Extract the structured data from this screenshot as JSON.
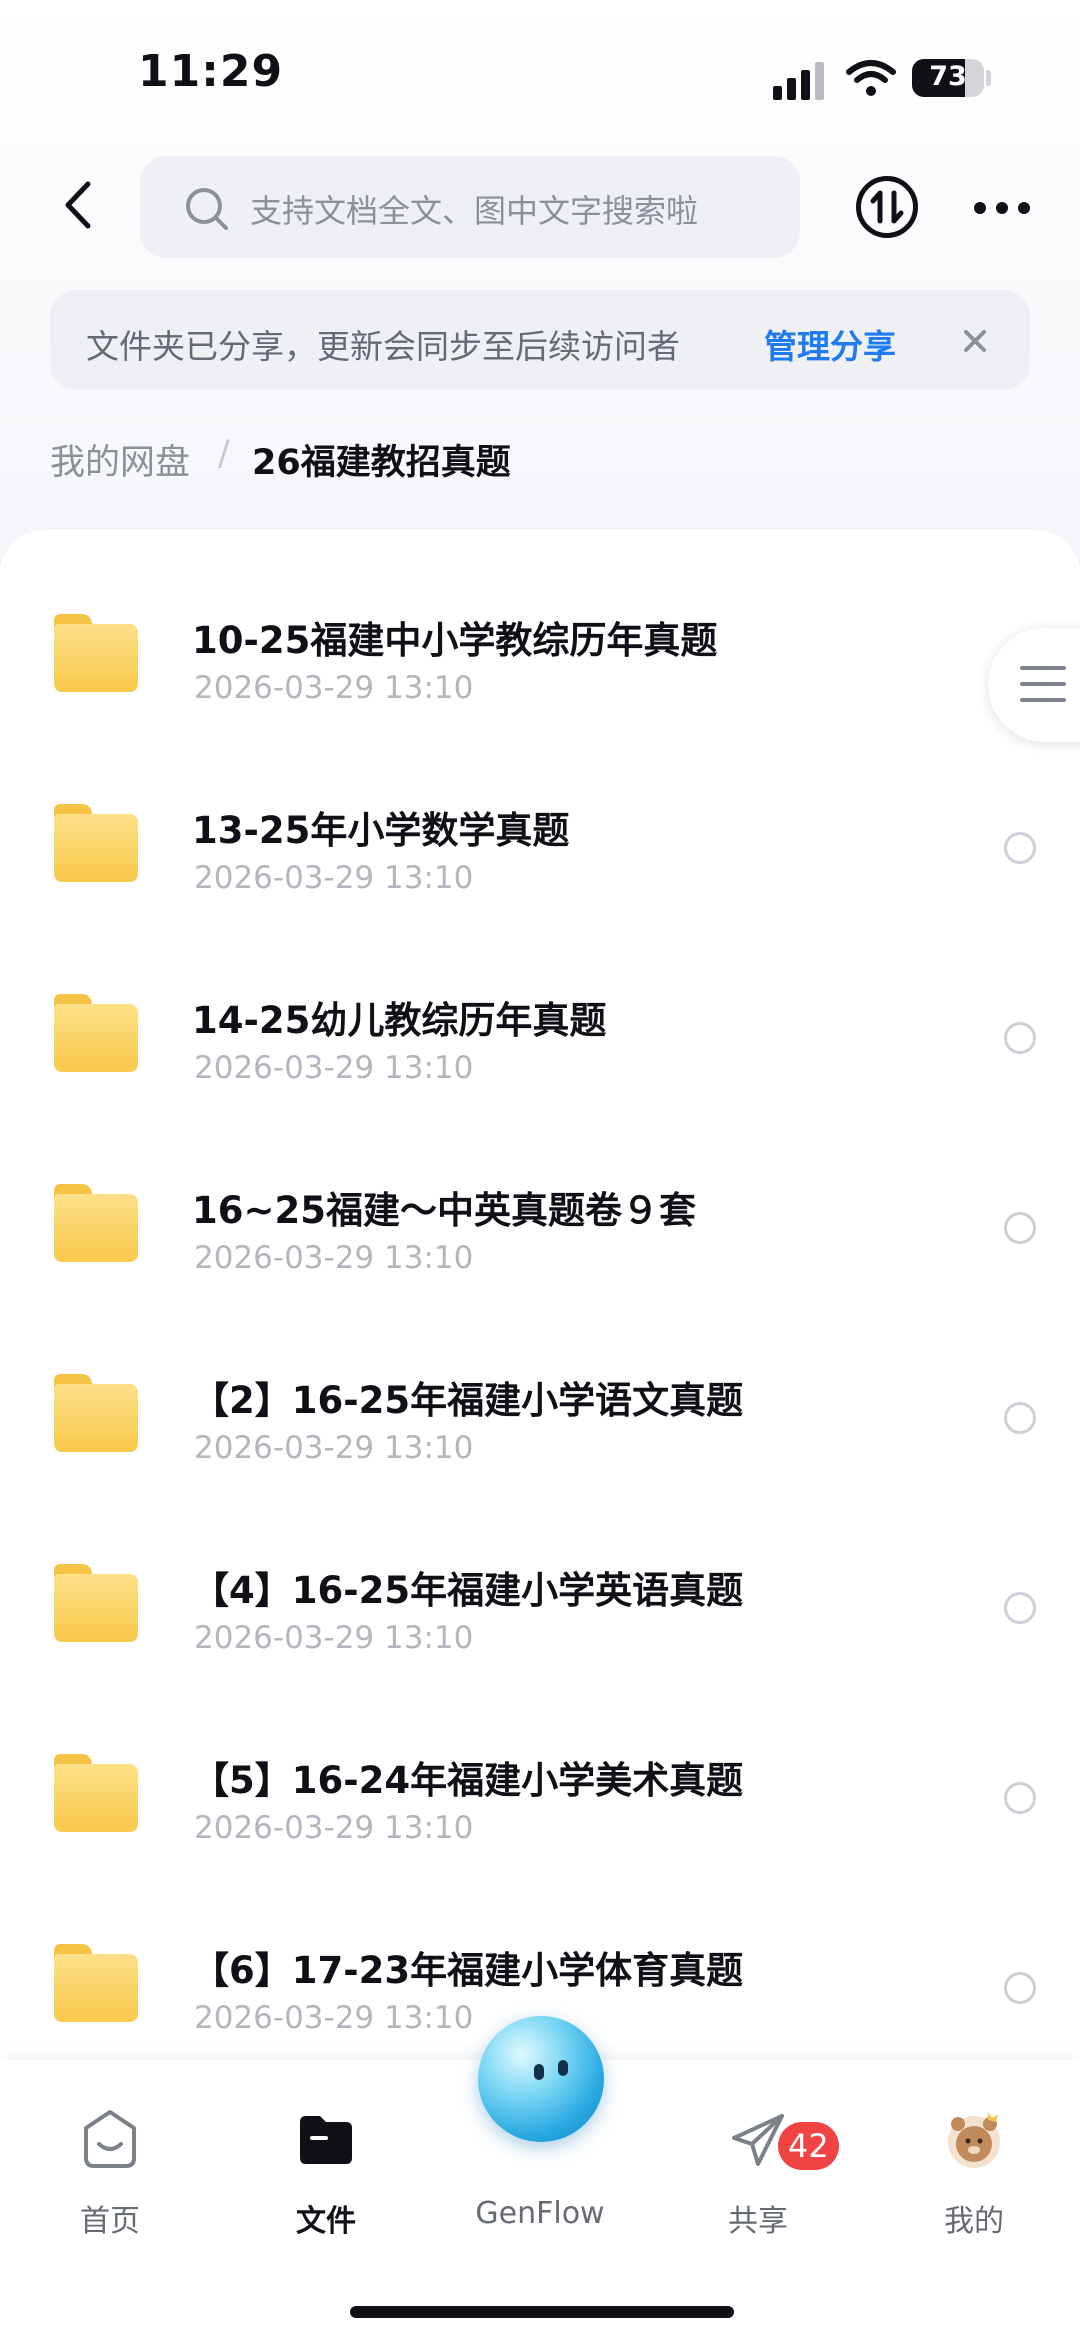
{
  "status_bar": {
    "time": "11:29",
    "battery": "73",
    "battery_level": 0.73
  },
  "header": {
    "search_placeholder": "支持文档全文、图中文字搜索啦"
  },
  "banner": {
    "text": "文件夹已分享，更新会同步至后续访问者",
    "link": "管理分享"
  },
  "breadcrumb": {
    "root": "我的网盘",
    "separator": "/",
    "current": "26福建教招真题"
  },
  "files": [
    {
      "name": "10-25福建中小学教综历年真题",
      "date": "2026-03-29 13:10"
    },
    {
      "name": "13-25年小学数学真题",
      "date": "2026-03-29 13:10"
    },
    {
      "name": "14-25幼儿教综历年真题",
      "date": "2026-03-29 13:10"
    },
    {
      "name": "16~25福建～中英真题卷９套",
      "date": "2026-03-29 13:10"
    },
    {
      "name": "【2】16-25年福建小学语文真题",
      "date": "2026-03-29 13:10"
    },
    {
      "name": "【4】16-25年福建小学英语真题",
      "date": "2026-03-29 13:10"
    },
    {
      "name": "【5】16-24年福建小学美术真题",
      "date": "2026-03-29 13:10"
    },
    {
      "name": "【6】17-23年福建小学体育真题",
      "date": "2026-03-29 13:10"
    }
  ],
  "tabbar": {
    "home": "首页",
    "files": "文件",
    "genflow": "GenFlow",
    "share": "共享",
    "share_badge": "42",
    "mine": "我的"
  },
  "colors": {
    "accent": "#1f7bf2",
    "folder": "#f8c94a",
    "badge": "#f04444"
  }
}
